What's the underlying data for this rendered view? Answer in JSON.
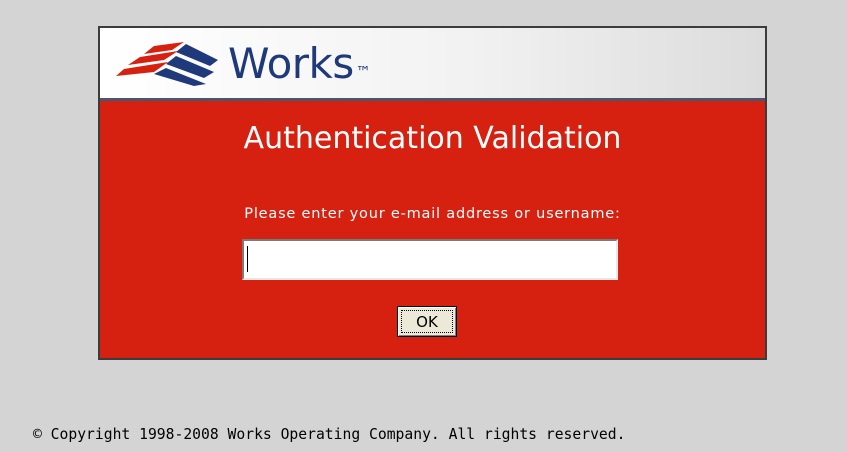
{
  "logo": {
    "text": "Works",
    "trademark": "™",
    "colors": {
      "red": "#d62010",
      "blue": "#1e3a7a"
    }
  },
  "dialog": {
    "title": "Authentication Validation",
    "prompt": "Please enter your e-mail address or username:",
    "input": {
      "value": "",
      "placeholder": ""
    },
    "ok_label": "OK"
  },
  "footer": {
    "copyright": "© Copyright 1998-2008 Works Operating Company. All rights reserved."
  },
  "colors": {
    "background": "#d4d4d4",
    "dialog_red": "#d62010",
    "header_border": "#4a5570"
  }
}
